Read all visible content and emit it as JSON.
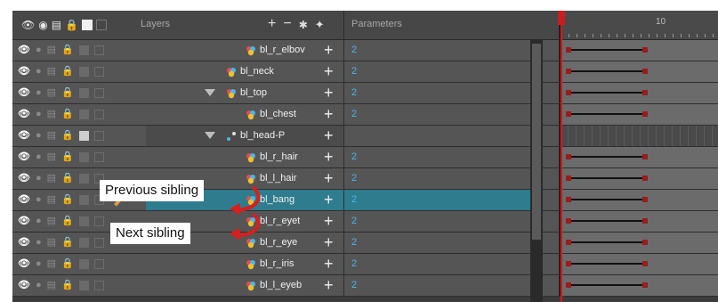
{
  "header": {
    "layers_label": "Layers",
    "parameters_label": "Parameters",
    "ruler_frame": "10",
    "column_icons": [
      "show-all-icon",
      "enable-all-icon",
      "toggle-all-icon",
      "lock-all-icon",
      "color-swatch-icon",
      "image-icon"
    ],
    "tool_icons": [
      "add-layer-icon",
      "delete-layer-icon",
      "add-peg-icon",
      "add-drawing-icon"
    ]
  },
  "layers": [
    {
      "name": "bl_r_elbov",
      "value": "2",
      "indent": "child",
      "type": "drawing",
      "selected": false
    },
    {
      "name": "bl_neck",
      "value": "2",
      "indent": "mid",
      "type": "drawing",
      "selected": false
    },
    {
      "name": "bl_top",
      "value": "2",
      "indent": "mid",
      "type": "drawing",
      "selected": false,
      "collapsed": true
    },
    {
      "name": "bl_chest",
      "value": "2",
      "indent": "child",
      "type": "drawing",
      "selected": false
    },
    {
      "name": "bl_head-P",
      "value": "",
      "indent": "mid",
      "type": "peg",
      "selected": false,
      "collapsed": true
    },
    {
      "name": "bl_r_hair",
      "value": "2",
      "indent": "child",
      "type": "drawing",
      "selected": false
    },
    {
      "name": "bl_l_hair",
      "value": "2",
      "indent": "child",
      "type": "drawing",
      "selected": false
    },
    {
      "name": "bl_bang",
      "value": "2",
      "indent": "child",
      "type": "drawing",
      "selected": true
    },
    {
      "name": "bl_r_eyet",
      "value": "2",
      "indent": "child",
      "type": "drawing",
      "selected": false
    },
    {
      "name": "bl_r_eye",
      "value": "2",
      "indent": "child",
      "type": "drawing",
      "selected": false
    },
    {
      "name": "bl_r_iris",
      "value": "2",
      "indent": "child",
      "type": "drawing",
      "selected": false
    },
    {
      "name": "bl_l_eyeb",
      "value": "2",
      "indent": "child",
      "type": "drawing",
      "selected": false
    }
  ],
  "callouts": {
    "previous": "Previous sibling",
    "next": "Next sibling"
  },
  "colors": {
    "selection": "#2f7c8e",
    "keyframe": "#9a1c1c",
    "playhead": "#c81e1e",
    "param_value": "#4fb4e8",
    "annotation_arrow": "#d42020"
  }
}
